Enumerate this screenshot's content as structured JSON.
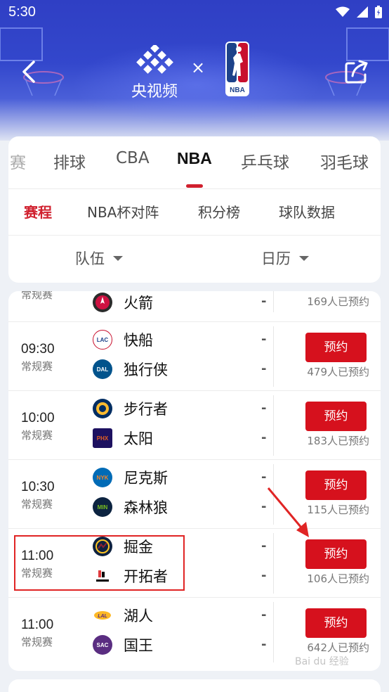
{
  "status_bar": {
    "time": "5:30"
  },
  "header": {
    "brand_name": "央视频",
    "separator": "×",
    "nba_logo_text": "NBA"
  },
  "sports_tabs": [
    {
      "label": "赛",
      "active": false
    },
    {
      "label": "排球",
      "active": false
    },
    {
      "label": "CBA",
      "active": false
    },
    {
      "label": "NBA",
      "active": true
    },
    {
      "label": "乒乓球",
      "active": false
    },
    {
      "label": "羽毛球",
      "active": false
    }
  ],
  "sub_tabs": [
    {
      "label": "赛程",
      "active": true
    },
    {
      "label": "NBA杯对阵",
      "active": false
    },
    {
      "label": "积分榜",
      "active": false
    },
    {
      "label": "球队数据",
      "active": false
    }
  ],
  "filters": {
    "team": "队伍",
    "calendar": "日历"
  },
  "matches": [
    {
      "time": "",
      "type": "常规赛",
      "teams": [
        {
          "name": "火箭",
          "logo": "rockets-logo",
          "score": "-"
        }
      ],
      "count": "169人已预约"
    },
    {
      "time": "09:30",
      "type": "常规赛",
      "teams": [
        {
          "name": "快船",
          "logo": "clippers-logo",
          "score": "-"
        },
        {
          "name": "独行侠",
          "logo": "mavericks-logo",
          "score": "-"
        }
      ],
      "button": "预约",
      "count": "479人已预约"
    },
    {
      "time": "10:00",
      "type": "常规赛",
      "teams": [
        {
          "name": "步行者",
          "logo": "pacers-logo",
          "score": "-"
        },
        {
          "name": "太阳",
          "logo": "suns-logo",
          "score": "-"
        }
      ],
      "button": "预约",
      "count": "183人已预约"
    },
    {
      "time": "10:30",
      "type": "常规赛",
      "teams": [
        {
          "name": "尼克斯",
          "logo": "knicks-logo",
          "score": "-"
        },
        {
          "name": "森林狼",
          "logo": "timberwolves-logo",
          "score": "-"
        }
      ],
      "button": "预约",
      "count": "115人已预约"
    },
    {
      "time": "11:00",
      "type": "常规赛",
      "teams": [
        {
          "name": "掘金",
          "logo": "nuggets-logo",
          "score": "-"
        },
        {
          "name": "开拓者",
          "logo": "trailblazers-logo",
          "score": "-"
        }
      ],
      "button": "预约",
      "count": "106人已预约"
    },
    {
      "time": "11:00",
      "type": "常规赛",
      "teams": [
        {
          "name": "湖人",
          "logo": "lakers-logo",
          "score": "-"
        },
        {
          "name": "国王",
          "logo": "kings-logo",
          "score": "-"
        }
      ],
      "button": "预约",
      "count": "642人已预约"
    }
  ],
  "colors": {
    "accent_red": "#d6111d",
    "header_blue": "#3347cc",
    "annotation_red": "#e02424"
  },
  "watermark": "Bai du 经验"
}
